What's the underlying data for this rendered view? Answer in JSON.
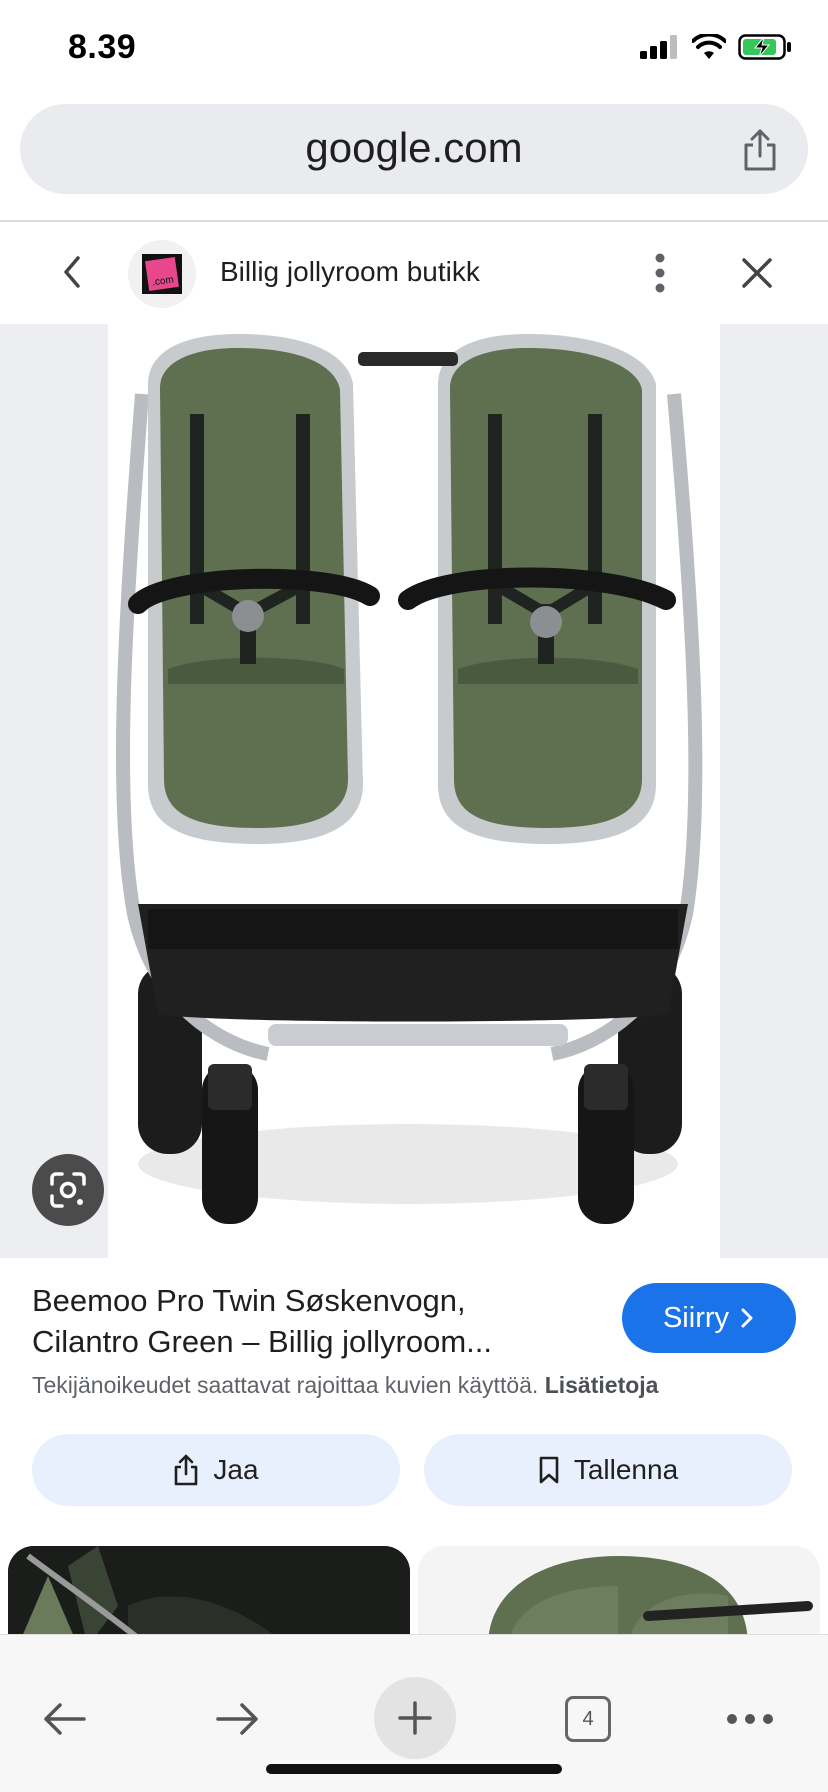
{
  "status": {
    "time": "8.39"
  },
  "browser": {
    "url": "google.com",
    "tab_count": "4"
  },
  "result": {
    "site_name": "Billig jollyroom butikk",
    "favicon_text": ".com",
    "title": "Beemoo Pro Twin Søskenvogn, Cilantro Green – Billig jollyroom...",
    "go_label": "Siirry",
    "copyright_text": "Tekijänoikeudet saattavat rajoittaa kuvien käyttöä.",
    "more_info_link": "Lisätietoja",
    "share_label": "Jaa",
    "save_label": "Tallenna"
  },
  "colors": {
    "accent": "#1a73e8",
    "action_bg": "#e8f0fe",
    "fabric_green": "#5e7050"
  }
}
